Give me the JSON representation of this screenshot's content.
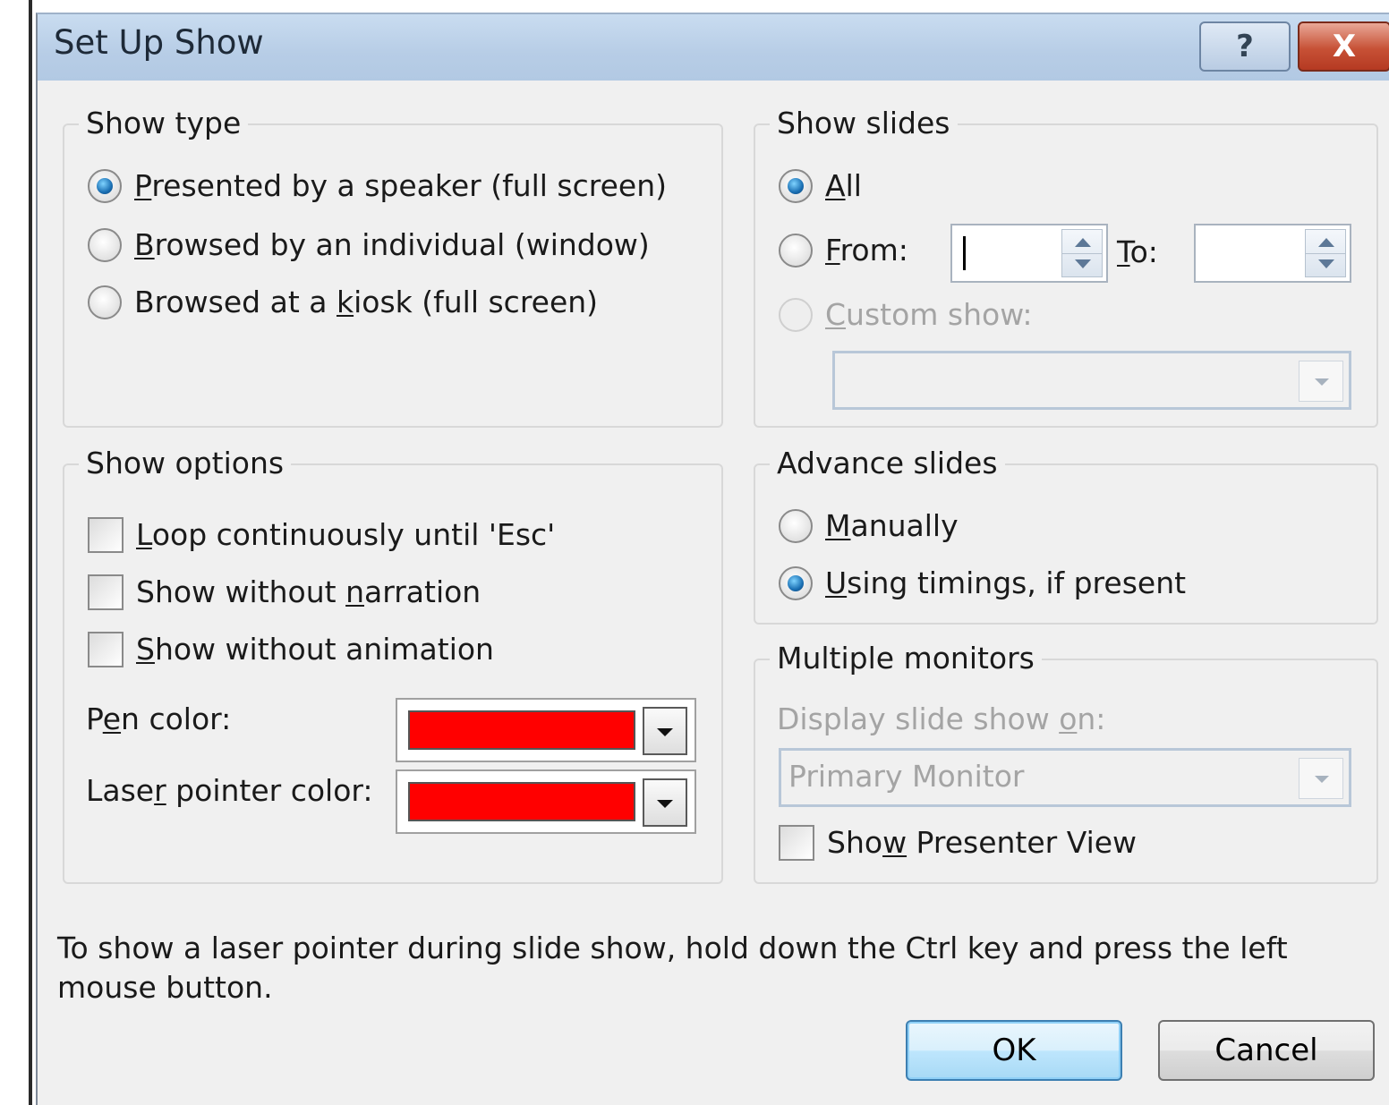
{
  "dialog": {
    "title": "Set Up Show",
    "help_label": "?",
    "close_label": "X"
  },
  "show_type": {
    "legend": "Show type",
    "options": [
      {
        "pre": "",
        "key": "P",
        "post": "resented by a speaker (full screen)",
        "checked": true
      },
      {
        "pre": "",
        "key": "B",
        "post": "rowsed by an individual (window)",
        "checked": false
      },
      {
        "pre": "Browsed at a ",
        "key": "k",
        "post": "iosk (full screen)",
        "checked": false
      }
    ]
  },
  "show_slides": {
    "legend": "Show slides",
    "all": {
      "key": "A",
      "post": "ll",
      "checked": true
    },
    "from": {
      "key": "F",
      "post": "rom:",
      "value": ""
    },
    "to": {
      "key": "T",
      "post": "o:",
      "value": ""
    },
    "custom": {
      "key": "C",
      "post": "ustom show:",
      "value": ""
    }
  },
  "show_options": {
    "legend": "Show options",
    "checks": [
      {
        "pre": "",
        "key": "L",
        "post": "oop continuously until 'Esc'",
        "checked": false
      },
      {
        "pre": "Show without ",
        "key": "n",
        "post": "arration",
        "checked": false
      },
      {
        "pre": "",
        "key": "S",
        "post": "how without animation",
        "checked": false
      }
    ],
    "pen": {
      "pre": "P",
      "key": "e",
      "post": "n color:",
      "color": "#ff0000"
    },
    "laser": {
      "pre": "Lase",
      "key": "r",
      "post": " pointer color:",
      "color": "#ff0000"
    }
  },
  "advance": {
    "legend": "Advance slides",
    "manual": {
      "key": "M",
      "post": "anually",
      "checked": false
    },
    "timings": {
      "key": "U",
      "post": "sing timings, if present",
      "checked": true
    }
  },
  "monitors": {
    "legend": "Multiple monitors",
    "display_pre": "Display slide show ",
    "display_key": "o",
    "display_post": "n:",
    "monitor_value": "Primary Monitor",
    "presenter": {
      "pre": "Sho",
      "key": "w",
      "post": " Presenter View",
      "checked": false
    }
  },
  "footer": {
    "note": "To show a laser pointer during slide show, hold down the Ctrl key and press the left mouse button.",
    "ok_label": "OK",
    "cancel_label": "Cancel"
  }
}
